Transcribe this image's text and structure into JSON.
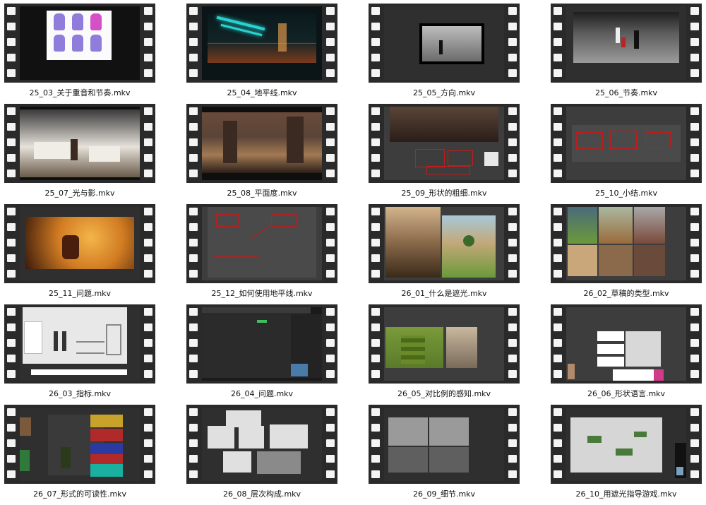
{
  "files": [
    {
      "name": "25_03_关于重音和节奏.mkv",
      "thumb": "thumb-characters",
      "colors": [
        "#111111",
        "#fbfbfb",
        "#8f7cdb"
      ]
    },
    {
      "name": "25_04_地平线.mkv",
      "thumb": "thumb-neon-street",
      "colors": [
        "#0b1416",
        "#27d3d0",
        "#7a3b1d"
      ]
    },
    {
      "name": "25_05_方向.mkv",
      "thumb": "thumb-photo-street",
      "colors": [
        "#2f2f2f",
        "#000000",
        "#cfcfcf"
      ]
    },
    {
      "name": "25_06_节奏.mkv",
      "thumb": "thumb-riot-street",
      "colors": [
        "#2f2f2f",
        "#1a1a1a",
        "#9b9b9b"
      ]
    },
    {
      "name": "25_07_光与影.mkv",
      "thumb": "thumb-living-room",
      "colors": [
        "#0e0e0e",
        "#e6e1da",
        "#6a5b4a"
      ]
    },
    {
      "name": "25_08_平面度.mkv",
      "thumb": "thumb-ruins",
      "colors": [
        "#0e0e0e",
        "#5a4438",
        "#a37a53"
      ]
    },
    {
      "name": "25_09_形状的粗细.mkv",
      "thumb": "thumb-ruins-sketch",
      "colors": [
        "#3d3d3d",
        "#5a4438",
        "#c41b1b"
      ]
    },
    {
      "name": "25_10_小结.mkv",
      "thumb": "thumb-red-shapes",
      "colors": [
        "#3d3d3d",
        "#4a4a4a",
        "#c41b1b"
      ]
    },
    {
      "name": "25_11_问题.mkv",
      "thumb": "thumb-fiery-scene",
      "colors": [
        "#2f2f2f",
        "#d17b22",
        "#3a1a0c"
      ]
    },
    {
      "name": "25_12_如何使用地平线.mkv",
      "thumb": "thumb-red-diagram",
      "colors": [
        "#3d3d3d",
        "#4a4a4a",
        "#c41b1b"
      ]
    },
    {
      "name": "26_01_什么是遮光.mkv",
      "thumb": "thumb-terrain",
      "colors": [
        "#3d3d3d",
        "#8a6a4a",
        "#6a9a3a"
      ]
    },
    {
      "name": "26_02_草稿的类型.mkv",
      "thumb": "thumb-collage",
      "colors": [
        "#3d3d3d",
        "#9a6a3a",
        "#6a9a3a"
      ]
    },
    {
      "name": "26_03_指标.mkv",
      "thumb": "thumb-metrics",
      "colors": [
        "#2f2f2f",
        "#e8e8e8",
        "#ffffff"
      ]
    },
    {
      "name": "26_04_问题.mkv",
      "thumb": "thumb-software",
      "colors": [
        "#1a1a1a",
        "#2b2b2b",
        "#3fbf5f"
      ]
    },
    {
      "name": "26_05_对比例的感知.mkv",
      "thumb": "thumb-game-scene",
      "colors": [
        "#3d3d3d",
        "#5a7a2a",
        "#c9b9a0"
      ]
    },
    {
      "name": "26_06_形状语言.mkv",
      "thumb": "thumb-logos",
      "colors": [
        "#3d3d3d",
        "#ffffff",
        "#2a2a2a"
      ]
    },
    {
      "name": "26_07_形式的可读性.mkv",
      "thumb": "thumb-cover-chart",
      "colors": [
        "#2f2f2f",
        "#c8a22a",
        "#3a8a3a"
      ]
    },
    {
      "name": "26_08_层次构成.mkv",
      "thumb": "thumb-boards",
      "colors": [
        "#2f2f2f",
        "#e0e0e0",
        "#8a8a8a"
      ]
    },
    {
      "name": "26_09_细节.mkv",
      "thumb": "thumb-grey-rooms",
      "colors": [
        "#2f2f2f",
        "#9a9a9a",
        "#5f5f5f"
      ]
    },
    {
      "name": "26_10_用遮光指导游戏.mkv",
      "thumb": "thumb-level-blockout",
      "colors": [
        "#2f2f2f",
        "#d6d6d6",
        "#4a7a3a"
      ]
    }
  ]
}
